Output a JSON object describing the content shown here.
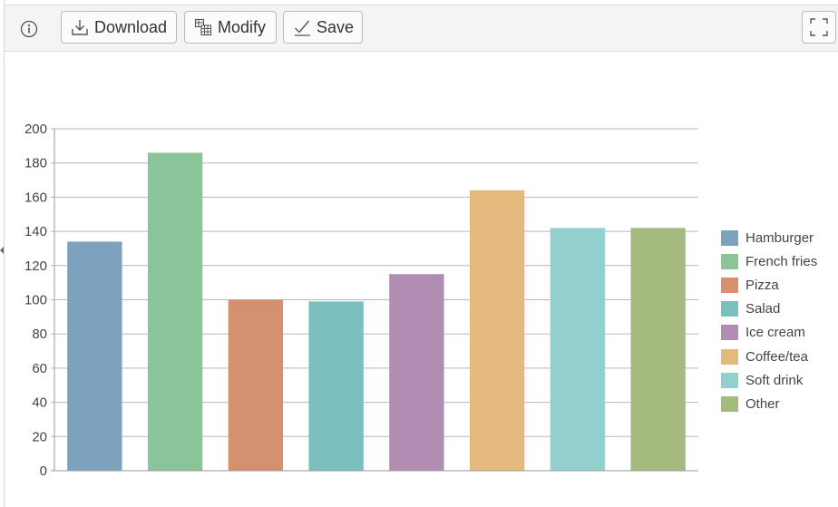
{
  "toolbar": {
    "download_label": "Download",
    "modify_label": "Modify",
    "save_label": "Save"
  },
  "icons": {
    "info": "info-icon",
    "download": "download-icon",
    "modify": "table-edit-icon",
    "save": "checkmark-icon",
    "fullscreen": "fullscreen-icon"
  },
  "chart_data": {
    "type": "bar",
    "categories": [
      "Hamburger",
      "French fries",
      "Pizza",
      "Salad",
      "Ice cream",
      "Coffee/tea",
      "Soft drink",
      "Other"
    ],
    "values": [
      134,
      186,
      100,
      99,
      115,
      164,
      142,
      142
    ],
    "colors": [
      "#7da2be",
      "#8cc49a",
      "#d4906f",
      "#7bbfbf",
      "#b18db4",
      "#e4b97e",
      "#93cfcc",
      "#a5ba7e"
    ],
    "ylim": [
      0,
      200
    ],
    "yticks": [
      "0",
      "20",
      "40",
      "60",
      "80",
      "100",
      "120",
      "140",
      "160",
      "180",
      "200"
    ],
    "grid": true,
    "legend_position": "right"
  }
}
